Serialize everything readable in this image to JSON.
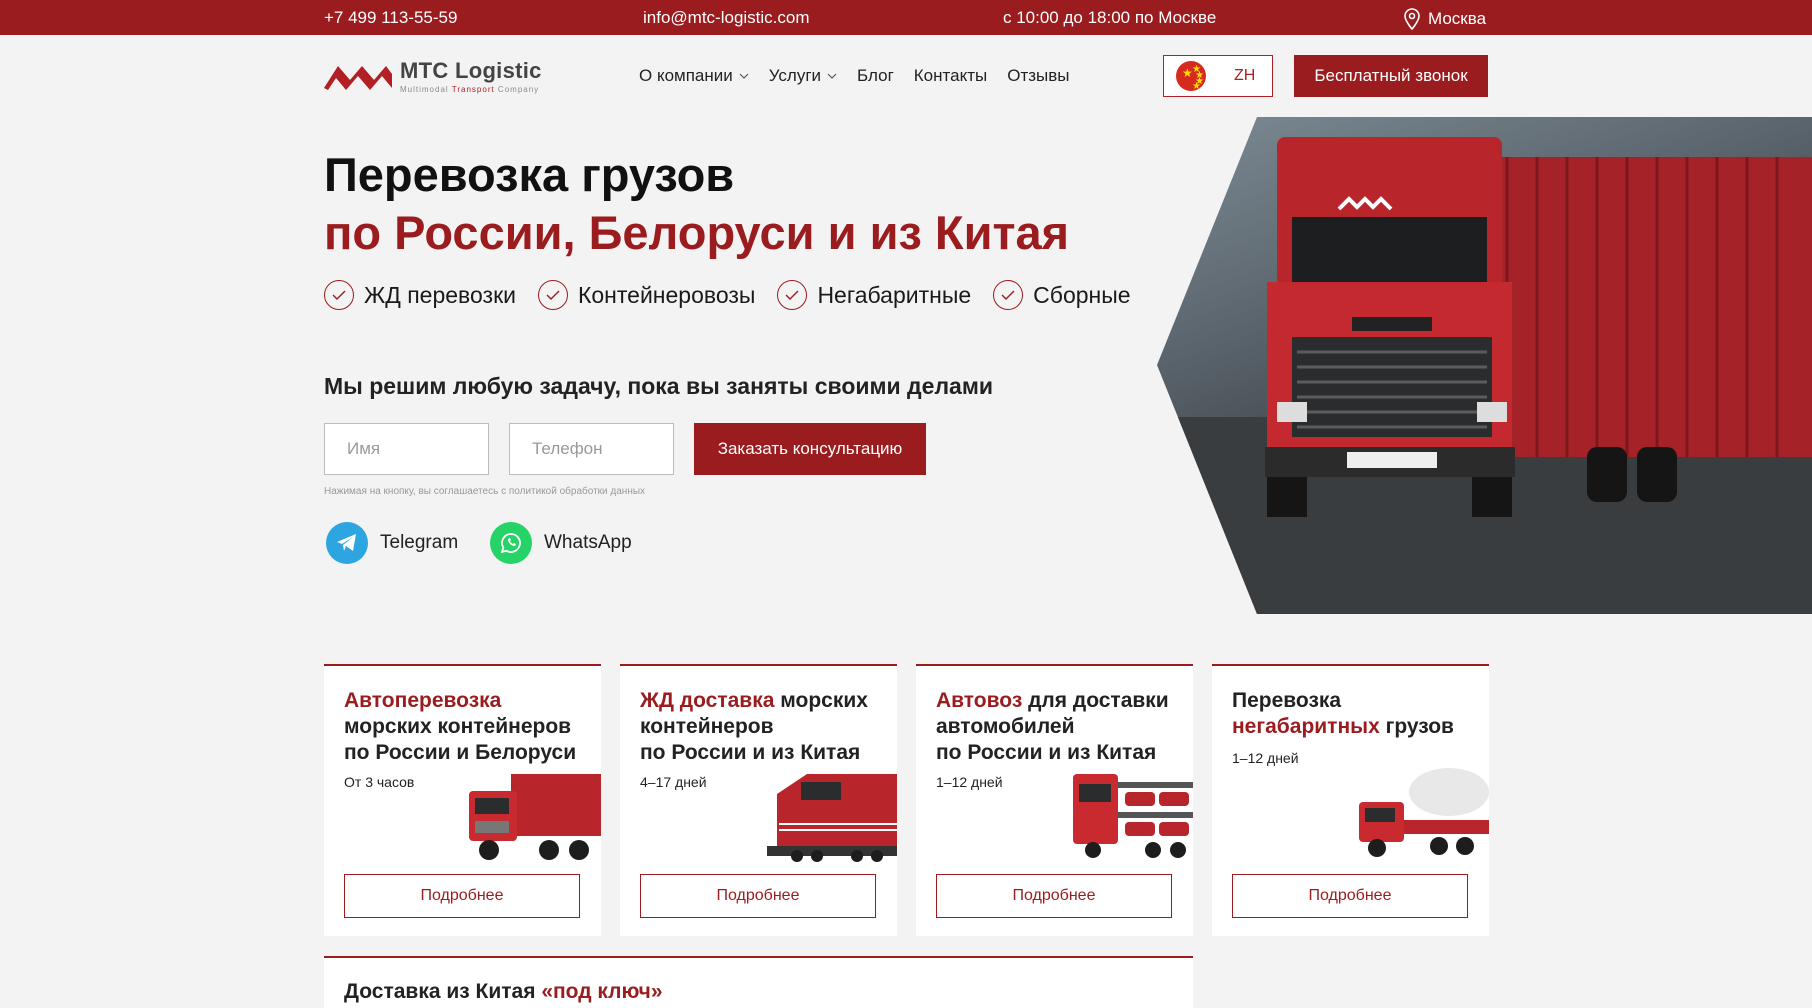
{
  "topbar": {
    "phone": "+7 499 113-55-59",
    "email": "info@mtc-logistic.com",
    "hours": "с 10:00 до 18:00 по Москве",
    "city": "Москва"
  },
  "logo": {
    "name": "MTC Logistic",
    "sub_1": "Multimodal ",
    "sub_2": "Transport",
    "sub_3": " Company"
  },
  "nav": [
    {
      "label": "О компании",
      "dropdown": true
    },
    {
      "label": "Услуги",
      "dropdown": true
    },
    {
      "label": "Блог",
      "dropdown": false
    },
    {
      "label": "Контакты",
      "dropdown": false
    },
    {
      "label": "Отзывы",
      "dropdown": false
    }
  ],
  "lang": {
    "code": "ZH"
  },
  "call_button": "Бесплатный звонок",
  "hero": {
    "title_line1": "Перевозка грузов",
    "title_line2": "по России, Белоруси и из Китая",
    "features": [
      "ЖД перевозки",
      "Контейнеровозы",
      "Негабаритные",
      "Сборные"
    ],
    "tagline": "Мы решим любую задачу, пока вы заняты своими делами",
    "name_placeholder": "Имя",
    "phone_placeholder": "Телефон",
    "consult_button": "Заказать консультацию",
    "policy": "Нажимая на кнопку, вы соглашаетесь с политикой обработки данных",
    "telegram": "Telegram",
    "whatsapp": "WhatsApp"
  },
  "cards": [
    {
      "title_red": "Автоперевозка",
      "title_rest_1": "морских контейнеров",
      "title_rest_2": "по России и Белоруси",
      "time": "От 3 часов",
      "more": "Подробнее"
    },
    {
      "title_red": "ЖД доставка",
      "title_rest_0": " морских",
      "title_rest_1": "контейнеров",
      "title_rest_2": "по России и из Китая",
      "time": "4–17 дней",
      "more": "Подробнее"
    },
    {
      "title_red": "Автовоз",
      "title_rest_0": " для доставки",
      "title_rest_1": "автомобилей",
      "title_rest_2": "по России и из Китая",
      "time": "1–12 дней",
      "more": "Подробнее"
    },
    {
      "title_plain": "Перевозка",
      "title_red": "негабаритных",
      "title_rest_0": " грузов",
      "time": "1–12 дней",
      "more": "Подробнее"
    }
  ],
  "bottom_card": {
    "title": "Доставка из Китая ",
    "title_red": "«под ключ»"
  },
  "colors": {
    "brand": "#9b1c1f",
    "background": "#f3f3f3"
  }
}
